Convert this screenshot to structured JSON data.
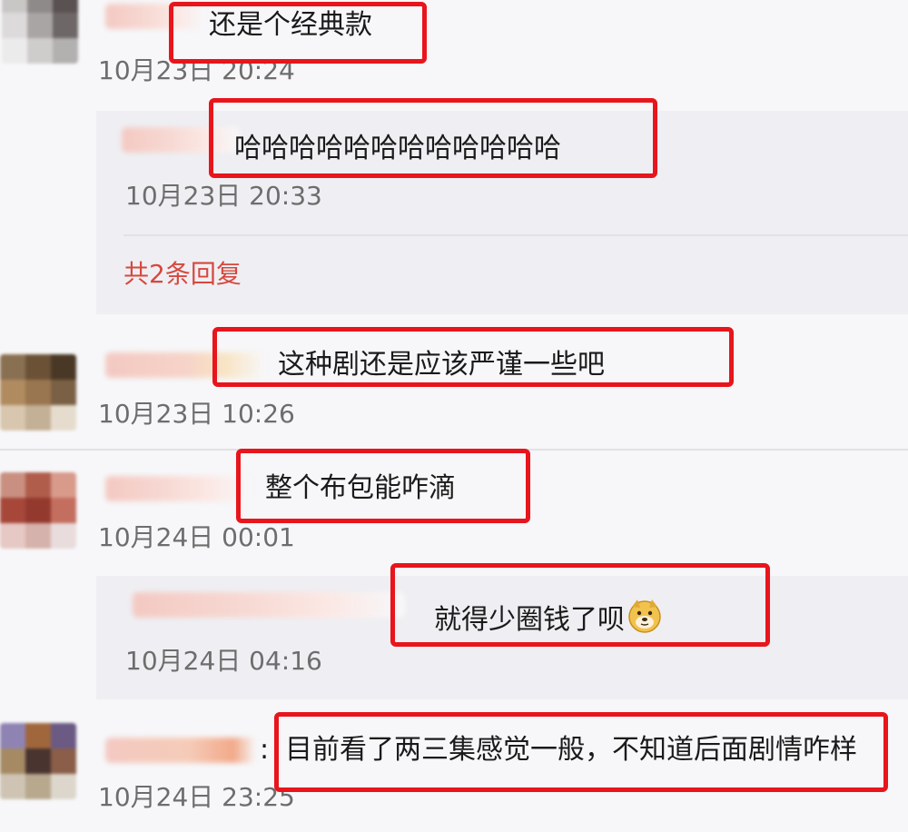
{
  "comments": [
    {
      "text": "还是个经典款",
      "time": "10月23日 20:24"
    },
    {
      "reply_text": "哈哈哈哈哈哈哈哈哈哈哈哈",
      "reply_time": "10月23日 20:33",
      "more_replies": "共2条回复"
    },
    {
      "text": "这种剧还是应该严谨一些吧",
      "time": "10月23日 10:26"
    },
    {
      "text": "整个布包能咋滴",
      "time": "10月24日 00:01"
    },
    {
      "reply_text": "就得少圈钱了呗",
      "reply_time": "10月24日 04:16",
      "reply_emoji": "doge-emoji-icon"
    },
    {
      "prefix": ":",
      "text": "目前看了两三集感觉一般，不知道后面剧情咋样",
      "time": "10月24日 23:25"
    }
  ],
  "colors": {
    "highlight": "#e8151c",
    "link": "#d6483e",
    "time": "#6d6d6d"
  }
}
